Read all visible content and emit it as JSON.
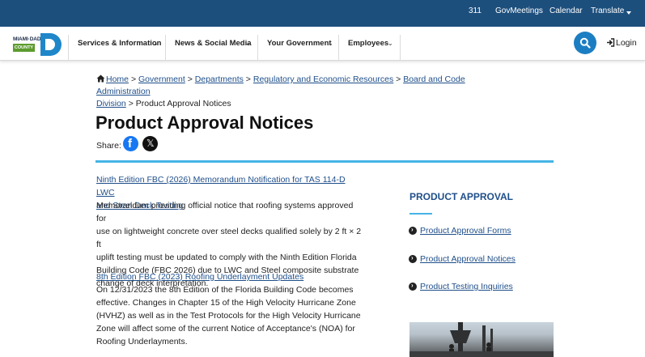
{
  "topbar": {
    "links": [
      "311",
      "GovMeetings",
      "Calendar",
      "Translate"
    ]
  },
  "logo": {
    "top_text": "MIAMI·DADE",
    "county_text": "COUNTY"
  },
  "nav": {
    "items": [
      "Services & Information",
      "News & Social Media",
      "Your Government",
      "Employees"
    ],
    "login_label": "Login"
  },
  "breadcrumb": {
    "home": "Home",
    "government": "Government",
    "departments": "Departments",
    "rer": "Regulatory and Economic Resources",
    "bca_line1": "Board and Code Administration",
    "bca_line2": "Division",
    "current": "Product Approval Notices",
    "separator": ">"
  },
  "page": {
    "title": "Product Approval Notices",
    "share_label": "Share:"
  },
  "notices": [
    {
      "title_line1": "Ninth Edition FBC (2026) Memorandum Notification for TAS 114-D LWC",
      "title_line2": "and Steel Deck Testing",
      "body": [
        "Memorandum providing official notice that roofing systems approved for",
        "use on lightweight concrete over steel decks qualified solely by 2 ft × 2 ft",
        "uplift testing must be updated to comply with the Ninth Edition Florida",
        "Building Code (FBC 2026) due to LWC and Steel composite substrate",
        "change of deck interpretation."
      ]
    },
    {
      "title_line1": "8th Edition FBC (2023) Roofing Underlayment Updates",
      "body": [
        "On 12/31/2023 the 8th Edition of the Florida Building Code becomes",
        "effective. Changes in Chapter 15 of the High Velocity Hurricane Zone",
        "(HVHZ) as well as in the Test Protocols for the High Velocity Hurricane",
        "Zone will affect some of the current Notice of Acceptance's (NOA) for",
        "Roofing Underlayments."
      ]
    }
  ],
  "sidebar": {
    "heading": "PRODUCT APPROVAL",
    "items": [
      "Product Approval Forms",
      "Product Approval Notices",
      "Product Testing Inquiries"
    ]
  },
  "colors": {
    "topbar": "#1d4f7d",
    "link": "#1f4f8a",
    "accent": "#45b4e6",
    "search": "#1b7ec2",
    "county_green": "#5d9c2f"
  },
  "icons": [
    "home-icon",
    "search-icon",
    "login-icon",
    "chevron-down-icon",
    "facebook-icon",
    "x-icon",
    "chevron-right-circle-icon"
  ]
}
